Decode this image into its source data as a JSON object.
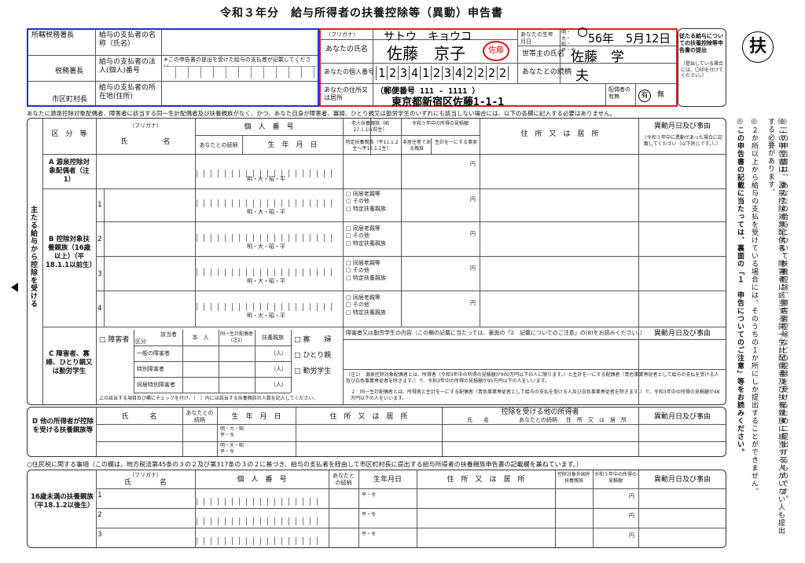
{
  "title": "令和３年分　給与所得者の扶養控除等（異動）申告書",
  "badge": "扶",
  "colors": {
    "blue_box": "#1d2fd6",
    "red_box": "#e0201e",
    "stamp": "#d11",
    "line": "#333"
  },
  "office": {
    "tax_office": "所轄税務署長",
    "tax_office_suffix": "税務署長",
    "city_suffix": "市区町村長",
    "payer_name": "給与の支払者の名称（氏名）",
    "payer_number": "給与の支払者の法人(個人)番号",
    "payer_number_note": "※この申告書の提出を受けた給与の支払者が記載してください。",
    "payer_address": "給与の支払者の所在地(住所)"
  },
  "applicant": {
    "furigana_label": "（フリガナ）",
    "furigana": "サトウ　キョウコ",
    "name_label": "あなたの氏名",
    "name": "佐藤　京子",
    "seal": "佐藤",
    "birth_label": "あなたの生年月日",
    "era_small": "明・大・昭・平・令",
    "birth": "56年　5月12日",
    "number_label": "あなたの個人番号",
    "number_digits": [
      "1",
      "2",
      "3",
      "4",
      "1",
      "2",
      "3",
      "4",
      "2",
      "2",
      "2",
      "2"
    ],
    "head_label": "世帯主の氏名",
    "head_name": "佐藤　学",
    "relation_label": "あなたとの続柄",
    "relation": "夫",
    "address_label": "あなたの住所又は居所",
    "postal": "（郵便番号 111 - 1111 ）",
    "address": "東京都新宿区佐藤1-1-1",
    "spouse_label": "配偶者の有無",
    "spouse_yes": "有",
    "spouse_no": "無"
  },
  "side_note": "従たる給与についての扶養控除等申告書の提出",
  "side_note_small": "（提出している場合には、〇印を付けてください。）",
  "intro": "あなたに源泉控除対象配偶者、障害者に該当する同一生計配偶者及び扶養親族がなく、かつ、あなた自身が障害者、寡婦、ひとり親又は勤労学生のいずれにも該当しない場合には、以下の各欄に記入する必要はありません。",
  "main_table": {
    "col_category": "区　分　等",
    "col_name": "氏　　　　　名",
    "col_furigana": "（フリガナ）",
    "col_number": "個　人　番　号",
    "col_relation": "あなたとの続柄",
    "col_birth": "生　年　月　日",
    "col_elderly": "老人扶養親族（昭27.1.1以前生）",
    "col_special": "特定扶養親族（平11.1.2生〜平15.1.1生）",
    "col_income": "令和３年中の所得の見積額",
    "col_nonres": "非居住者である親族",
    "col_remit": "生計を一にする事実",
    "col_address": "住　所　又　は　居　所",
    "col_change": "異動月日及び事由",
    "col_change_note": "（令和３年中に異動があった場合に記載してください（以下同じです。）。）",
    "side_label": "主たる給与から控除を受ける",
    "sec_a": "A 源泉控除対象配偶者（注1）",
    "sec_b": "B 控除対象扶養親族（16歳以上）（平18.1.1以前生）",
    "rows_b": [
      "1",
      "2",
      "3",
      "4"
    ],
    "era": "明・大・昭・平",
    "yen": "円",
    "opt_cohabit": "同居老親等",
    "opt_other": "その他",
    "opt_special": "特定扶養親族"
  },
  "section_c": {
    "label": "C 障害者、寡婦、ひとり親又は勤労学生",
    "disabled": "障害者",
    "cat_header": "区分",
    "applicant_header": "該当者",
    "self": "本　人",
    "same_spouse": "同一生計配偶者(注2)",
    "dependent": "扶養親族",
    "general": "一般の障害者",
    "special": "特別障害者",
    "cohabit_special": "同居特別障害者",
    "persons": "（人）",
    "widow": "寡　　婦",
    "single_parent": "ひとり親",
    "student": "勤労学生",
    "check_note": "上の該当する項目及び欄にチェックを付け、（　）内には該当する扶養親族の人数を記入してください。",
    "detail_label": "障害者又は勤労学生の内容（この欄の記載に当たっては、裏面の「2　記載についてのご注意」の(8)をお読みください。）",
    "change_label": "異動月日及び事由",
    "note1": "（注1）　源泉控除対象配偶者とは、所得者（令和3年中の所得の見積額が900万円以下の人に限ります。）と生計を一にする配偶者（青色事業専従者として給与の支払を受ける人及び白色事業専従者を除きます。）で、令和3年中の所得の見積額が95万円以下の人をいいます。",
    "note2": "２　同一生計配偶者とは、所得者と生計を一にする配偶者（青色事業専従者として給与の支払を受ける人及び白色事業専従者を除きます。）で、令和3年中の所得の見積額が48万円以下の人をいいます。"
  },
  "section_d": {
    "label": "D 他の所得者が控除を受ける扶養親族等",
    "col_name": "氏　　　名",
    "col_relation": "あなたとの続柄",
    "col_birth": "生　年　月　日",
    "col_address": "住　所　又　は　居　所",
    "col_other": "控除を受ける他の所得者",
    "col_other_name": "氏　　名",
    "col_other_relation": "あなたとの続柄",
    "col_other_address": "住　所　又　は　居　所",
    "col_change": "異動月日及び事由",
    "era_a": "明・大・昭",
    "era_b": "平・令"
  },
  "resident": {
    "heading": "○住民税に関する事項（この欄は、地方税法第45条の３の２及び第317条の３の２に基づき、給与の支払者を経由して市区町村長に提出する給与所得者の扶養親族申告書の記載欄を兼ねています。）",
    "label": "16歳未満の扶養親族（平18.1.2以後生）",
    "col_name": "氏　　　　名",
    "col_furigana": "（フリガナ）",
    "col_number": "個　人　番　号",
    "col_relation": "あなたとの続柄",
    "col_birth": "生年月日",
    "col_address": "住　所　又　は　居　所",
    "col_foreign": "控除対象外国外扶養親族",
    "col_income": "令和３年中の所得の見積額",
    "col_change": "異動月日及び事由",
    "rows": [
      "1",
      "2",
      "3"
    ],
    "era": "平・令",
    "yen": "円"
  },
  "right_notes": [
    "◎この申告書は、あなたの給与について扶養控除、障害者控除などの控除を受けるために提出するものです。",
    "◎この申告書は、源泉控除対象配偶者、障害者に該当する同一生計配偶者及び扶養親族に該当する人がいない人も提出する必要があります。",
    "◎２か所以上から給与の支払を受けている場合には、そのうちの１か所にしか提出することができません。",
    "◎この申告書の記載に当たっては、裏面の「１　申告についてのご注意」等をお読みください。"
  ]
}
